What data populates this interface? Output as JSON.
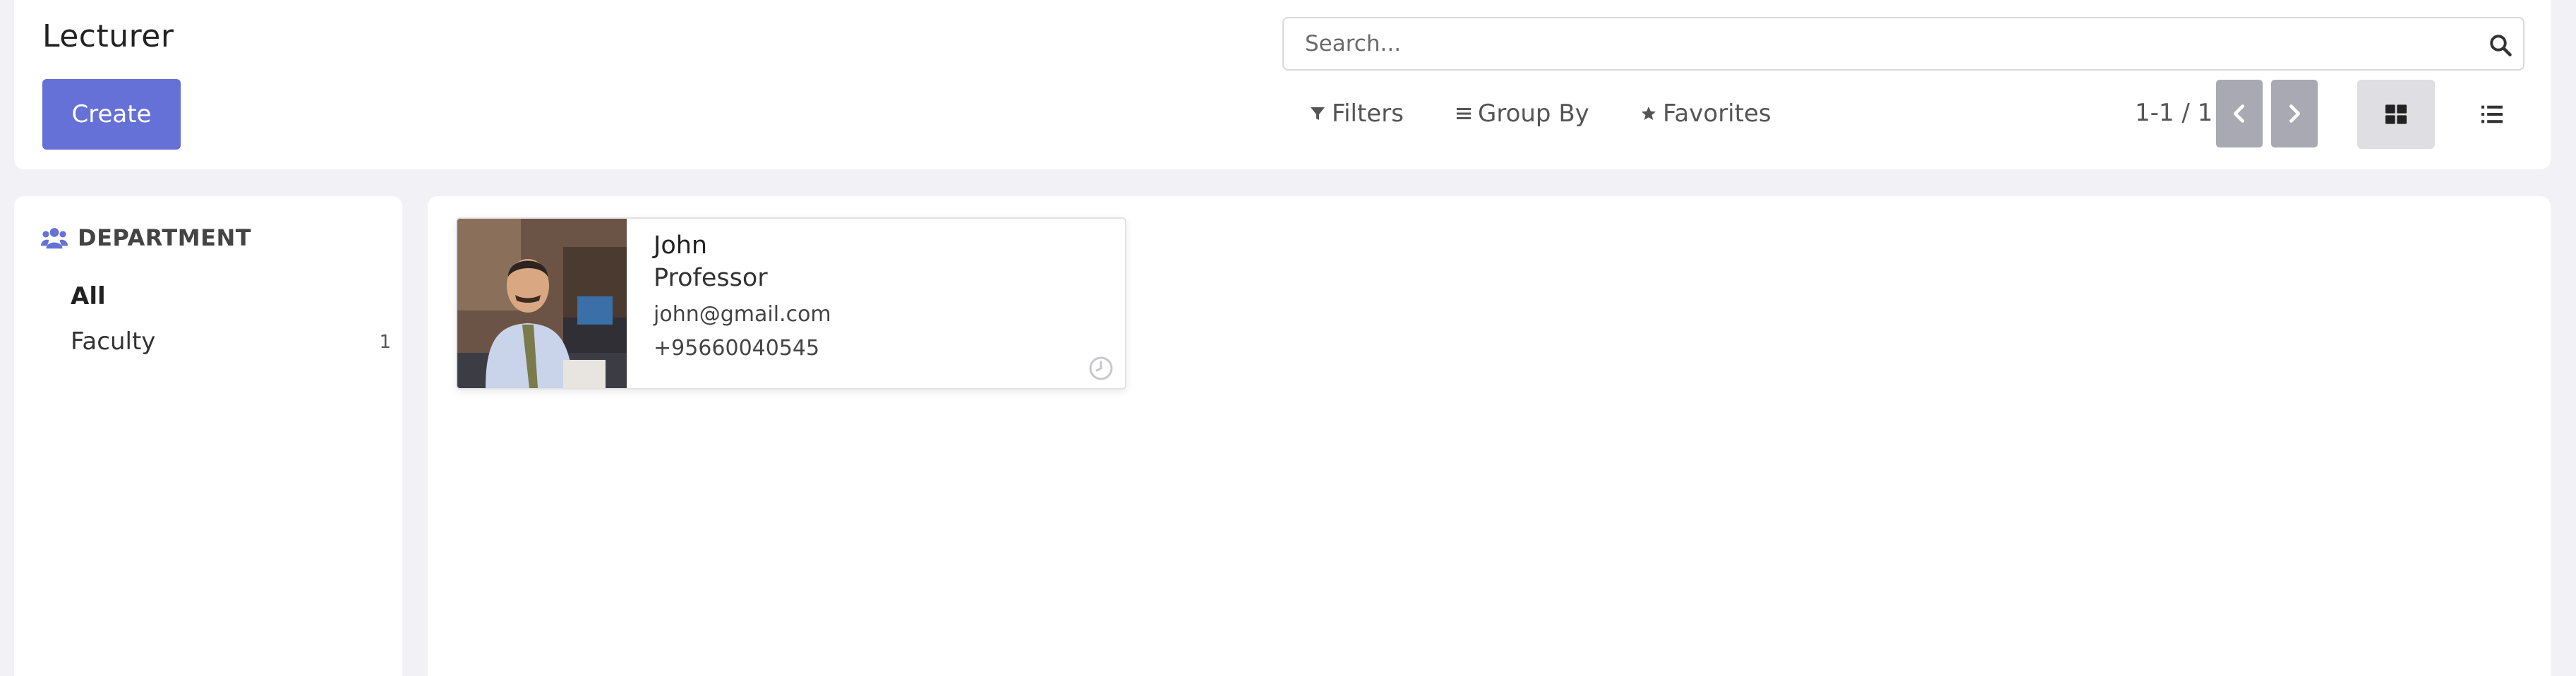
{
  "header": {
    "title": "Lecturer",
    "create_label": "Create"
  },
  "search": {
    "placeholder": "Search..."
  },
  "filters": {
    "filters_label": "Filters",
    "group_by_label": "Group By",
    "favorites_label": "Favorites"
  },
  "pager": {
    "value": "1-1 / 1"
  },
  "sidepanel": {
    "header": "DEPARTMENT",
    "items": [
      {
        "label": "All",
        "count": ""
      },
      {
        "label": "Faculty",
        "count": "1"
      }
    ]
  },
  "cards": [
    {
      "name": "John",
      "job_title": "Professor",
      "email": "john@gmail.com",
      "phone": "+95660040545"
    }
  ],
  "colors": {
    "primary": "#6571d6",
    "pager_button": "#a9a9b3",
    "background": "#f2f1f6"
  },
  "icons": {
    "search": "magnifier",
    "filters": "funnel",
    "group_by": "bars",
    "favorites": "star",
    "pager_previous": "chevron-left",
    "pager_next": "chevron-right",
    "kanban_view": "grid",
    "list_view": "list",
    "department": "users",
    "activity": "clock"
  }
}
